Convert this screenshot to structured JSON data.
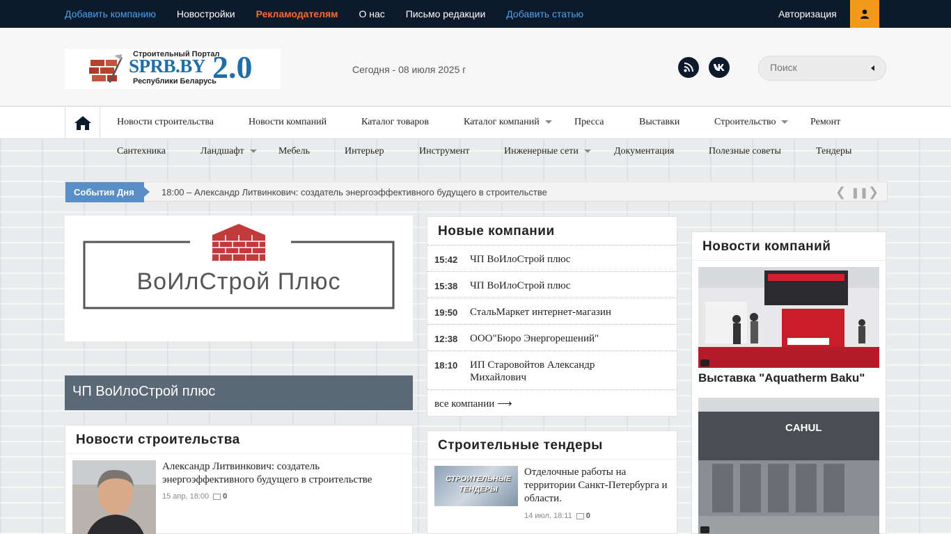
{
  "topbar": {
    "links": [
      {
        "label": "Добавить компанию",
        "style": "blue"
      },
      {
        "label": "Новостройки",
        "style": "white"
      },
      {
        "label": "Рекламодателям",
        "style": "orange"
      },
      {
        "label": "О нас",
        "style": "white"
      },
      {
        "label": "Письмо редакции",
        "style": "white"
      },
      {
        "label": "Добавить статью",
        "style": "blue"
      }
    ],
    "auth_label": "Авторизация",
    "user_icon": "user-icon"
  },
  "header": {
    "logo": {
      "top_text": "Строительный Портал",
      "main_text": "SPRB.BY",
      "bottom_text": "Республики Беларусь",
      "version": "2.0"
    },
    "date": "Сегодня - 08 июля 2025 г",
    "social": [
      "rss-icon",
      "vk-icon"
    ],
    "search_placeholder": "Поиск"
  },
  "nav": {
    "row1": [
      {
        "label": "Новости строительства",
        "dropdown": false
      },
      {
        "label": "Новости компаний",
        "dropdown": false
      },
      {
        "label": "Каталог товаров",
        "dropdown": false
      },
      {
        "label": "Каталог компаний",
        "dropdown": true
      },
      {
        "label": "Пресса",
        "dropdown": false
      },
      {
        "label": "Выставки",
        "dropdown": false
      },
      {
        "label": "Строительство",
        "dropdown": true
      },
      {
        "label": "Ремонт",
        "dropdown": false
      }
    ],
    "row2": [
      {
        "label": "Сантехника",
        "dropdown": false
      },
      {
        "label": "Ландшафт",
        "dropdown": true
      },
      {
        "label": "Мебель",
        "dropdown": false
      },
      {
        "label": "Интерьер",
        "dropdown": false
      },
      {
        "label": "Инструмент",
        "dropdown": false
      },
      {
        "label": "Инженерные сети",
        "dropdown": true
      },
      {
        "label": "Документация",
        "dropdown": false
      },
      {
        "label": "Полезные советы",
        "dropdown": false
      },
      {
        "label": "Тендеры",
        "dropdown": false
      }
    ]
  },
  "ticker": {
    "label": "События Дня",
    "text": "18:00 – Александр Литвинкович: создатель энергоэффективного будущего в строительстве"
  },
  "featured": {
    "logo_text": "ВоИлСтрой Плюс",
    "caption": "ЧП ВоИлоСтрой плюс"
  },
  "new_companies": {
    "title": "Новые компании",
    "items": [
      {
        "time": "15:42",
        "name": "ЧП ВоИлоСтрой плюс"
      },
      {
        "time": "15:38",
        "name": "ЧП ВоИлоСтрой плюс"
      },
      {
        "time": "19:50",
        "name": "СтальМаркет интернет-магазин"
      },
      {
        "time": "12:38",
        "name": "ООО\"Бюро Энергорешений\""
      },
      {
        "time": "18:10",
        "name": "ИП Старовойтов Александр Михайлович"
      }
    ],
    "all_link": "все компании ⟶"
  },
  "tenders": {
    "title": "Строительные тендеры",
    "thumb_text": "СТРОИТЕЛЬНЫЕ ТЕНДЕРЫ",
    "item_title": "Отделочные работы на территории Санкт-Петербурга и области.",
    "date": "14 июл, 18:11",
    "comments": "0"
  },
  "build_news": {
    "title": "Новости строительства",
    "item_title": "Александр Литвинкович: создатель энергоэффективного будущего в строительстве",
    "date": "15 апр, 18:00",
    "comments": "0"
  },
  "company_news": {
    "title": "Новости компаний",
    "item1_title": "Выставка \"Aquatherm Baku\"",
    "item2_sign": "CAHUL"
  },
  "colors": {
    "topbar_bg": "#0c1a2c",
    "accent_orange": "#f39a1c",
    "link_blue": "#4da3f2",
    "ticker_label": "#5a8ec7",
    "caption_bg": "#5b6876"
  }
}
